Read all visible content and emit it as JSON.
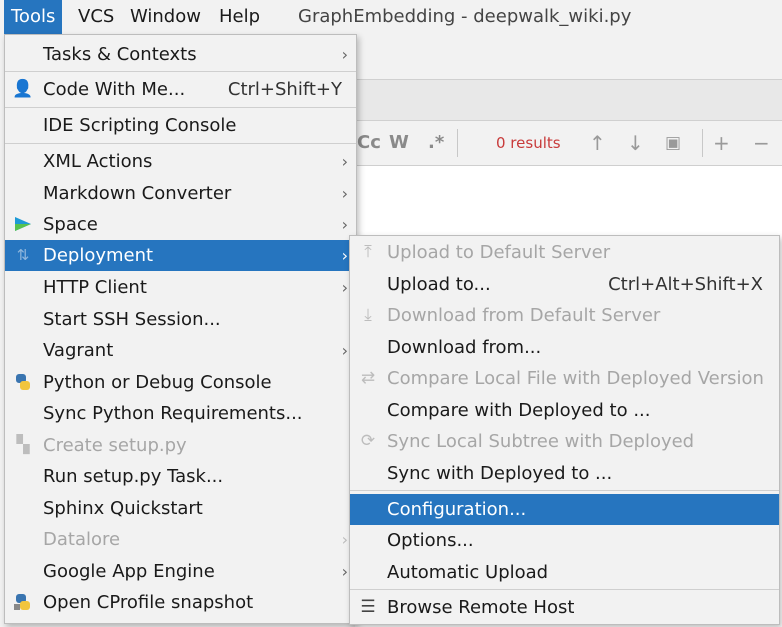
{
  "menubar": {
    "items": [
      {
        "label": "Tools"
      },
      {
        "label": "VCS"
      },
      {
        "label": "Window"
      },
      {
        "label": "Help"
      }
    ],
    "title": "GraphEmbedding - deepwalk_wiki.py"
  },
  "search": {
    "match_case": "Cc",
    "words": "W",
    "regex": ".*",
    "results": "0 results"
  },
  "tools_menu": {
    "items": [
      {
        "label": "Tasks & Contexts"
      },
      {
        "label": "Code With Me...",
        "shortcut": "Ctrl+Shift+Y"
      },
      {
        "label": "IDE Scripting Console"
      },
      {
        "label": "XML Actions"
      },
      {
        "label": "Markdown Converter"
      },
      {
        "label": "Space"
      },
      {
        "label": "Deployment"
      },
      {
        "label": "HTTP Client"
      },
      {
        "label": "Start SSH Session..."
      },
      {
        "label": "Vagrant"
      },
      {
        "label": "Python or Debug Console"
      },
      {
        "label": "Sync Python Requirements..."
      },
      {
        "label": "Create setup.py"
      },
      {
        "label": "Run setup.py Task..."
      },
      {
        "label": "Sphinx Quickstart"
      },
      {
        "label": "Datalore"
      },
      {
        "label": "Google App Engine"
      },
      {
        "label": "Open CProfile snapshot"
      }
    ]
  },
  "deploy_menu": {
    "items": [
      {
        "label": "Upload to Default Server"
      },
      {
        "label": "Upload to...",
        "shortcut": "Ctrl+Alt+Shift+X"
      },
      {
        "label": "Download from Default Server"
      },
      {
        "label": "Download from..."
      },
      {
        "label": "Compare Local File with Deployed Version"
      },
      {
        "label": "Compare with Deployed to ..."
      },
      {
        "label": "Sync Local Subtree with Deployed"
      },
      {
        "label": "Sync with Deployed to ..."
      },
      {
        "label": "Configuration..."
      },
      {
        "label": "Options..."
      },
      {
        "label": "Automatic Upload"
      },
      {
        "label": "Browse Remote Host"
      }
    ]
  },
  "colors": {
    "selection": "#2675bf",
    "results_text": "#c83b3b"
  }
}
